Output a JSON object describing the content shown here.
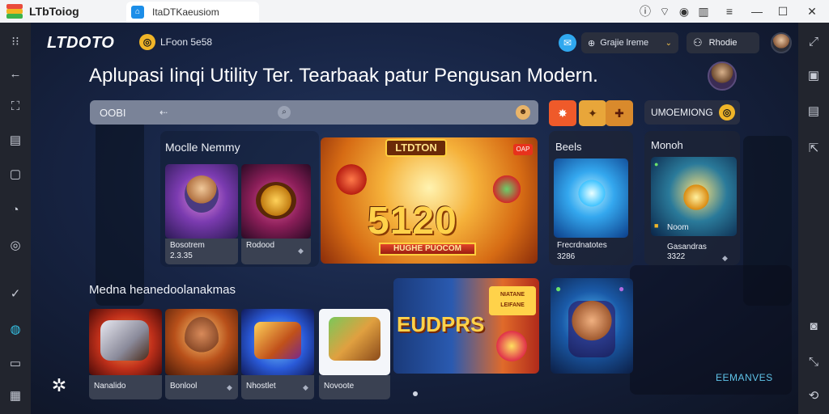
{
  "titlebar": {
    "app_title": "LTbToiog",
    "tab_label": "ItaDTKaeusiom"
  },
  "header": {
    "brand": "LTDOTO",
    "brand_tag": "LFoon 5e58",
    "language_label": "Grajie lreme",
    "user_label": "Rhodie"
  },
  "headline": "Aplupasi Iinqi Utility Ter. Tearbaak patur Pengusan Modern.",
  "search": {
    "value": "OOBI"
  },
  "sections": {
    "mobile_title": "Moclle Nemmy",
    "promo_title": "LTDTON",
    "promo_amount": "5120",
    "promo_banner": "HUGHE PUOCOM",
    "promo_corner": "OAP",
    "beals_title": "Beels",
    "beals_sub1": "Frecrdnatotes",
    "beals_sub2": "3286",
    "promo2_title": "UMOEMIONG",
    "monoh_title": "Monoh",
    "monoh_item1": "Noom",
    "monoh_item2": "Gasandras",
    "monoh_item3": "3322",
    "second_row_title": "Medna heanedoolanakmas",
    "footer_link": "EEMANVES"
  },
  "mobile_cards": [
    {
      "name": "Bosotrem",
      "sub": "2.3.35"
    },
    {
      "name": "Rodood",
      "sub": ""
    }
  ],
  "bottom_cards": [
    {
      "name": "Nanalido"
    },
    {
      "name": "Bonlool"
    },
    {
      "name": "Nhostlet"
    },
    {
      "name": "Novoote"
    }
  ],
  "bottom_promo": {
    "big_text": "EUDPRS NIDK",
    "small_text": "NIATANE LEIFANE"
  },
  "colors": {
    "accent_gold": "#f0b528",
    "accent_blue": "#30a8ef",
    "bg_dark": "#172444"
  }
}
